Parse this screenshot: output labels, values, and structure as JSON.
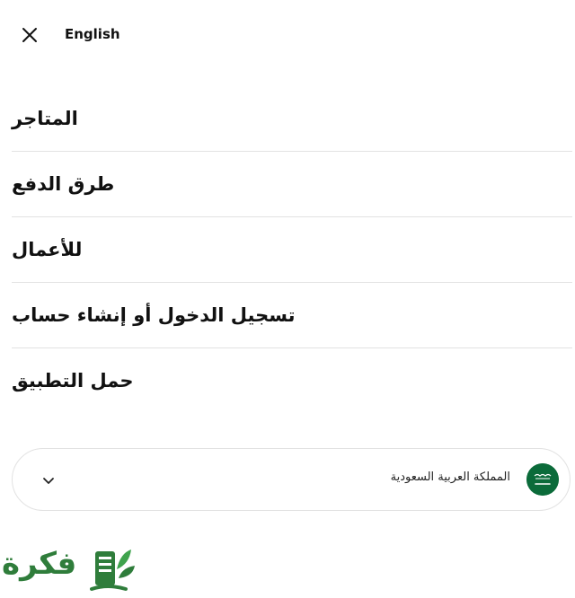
{
  "header": {
    "close_icon": "close-icon",
    "language_label": "English"
  },
  "menu": {
    "items": [
      {
        "label": "المتاجر"
      },
      {
        "label": "طرق الدفع"
      },
      {
        "label": "للأعمال"
      },
      {
        "label": "تسجيل الدخول أو إنشاء حساب"
      },
      {
        "label": "حمل التطبيق"
      }
    ]
  },
  "country_selector": {
    "selected": "المملكة العربية السعودية",
    "flag_icon": "saudi-flag-icon",
    "chevron_icon": "chevron-down-icon"
  },
  "watermark": {
    "text": "فكرة",
    "icon": "book-leaf-icon",
    "color": "#2f7d3b"
  }
}
